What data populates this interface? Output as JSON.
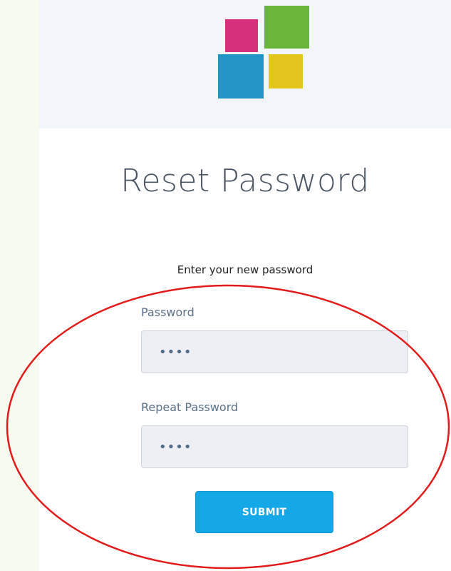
{
  "colors": {
    "outer_background": "#f7faef",
    "page_background": "#ffffff",
    "header_background": "#f2f6fa",
    "logo_pink": "#d6307a",
    "logo_green": "#6bb43a",
    "logo_blue": "#2196c6",
    "logo_yellow": "#e2c61e",
    "submit_background": "#15a8e8",
    "annotation_stroke": "#e21a1a"
  },
  "logo": {
    "icon": "four-squares-logo-icon"
  },
  "page": {
    "title": "Reset Password",
    "subtitle": "Enter your new password"
  },
  "form": {
    "password_label": "Password",
    "password_value": "••••",
    "repeat_password_label": "Repeat Password",
    "repeat_password_value": "••••",
    "submit_label": "SUBMIT"
  }
}
